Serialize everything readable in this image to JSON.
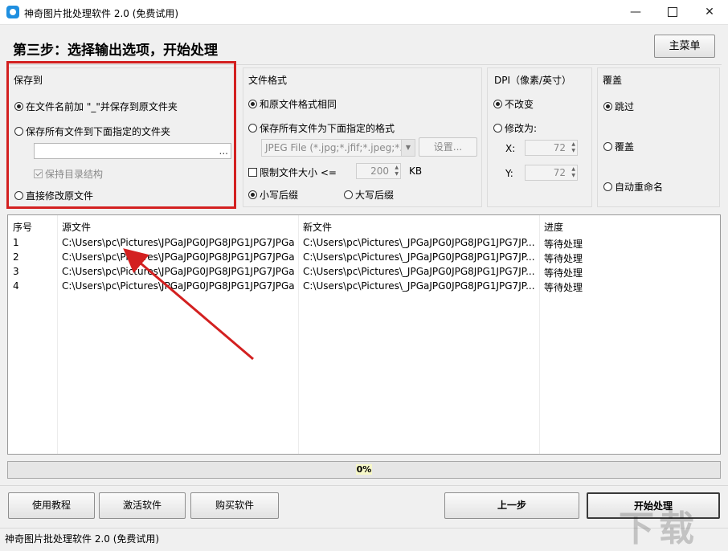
{
  "window": {
    "title": "神奇图片批处理软件 2.0 (免费试用)",
    "min_glyph": "—",
    "close_glyph": "✕"
  },
  "header": {
    "step_title": "第三步：选择输出选项，开始处理",
    "main_menu": "主菜单"
  },
  "save_to": {
    "title": "保存到",
    "option_prefix": "在文件名前加 \"_\"并保存到原文件夹",
    "option_folder": "保存所有文件到下面指定的文件夹",
    "folder_value": "",
    "browse": "...",
    "keep_structure": "保持目录结构",
    "option_overwrite": "直接修改原文件"
  },
  "file_format": {
    "title": "文件格式",
    "option_same": "和原文件格式相同",
    "option_convert": "保存所有文件为下面指定的格式",
    "format_value": "JPEG File (*.jpg;*.jfif;*.jpeg;*.jpe)",
    "settings": "设置...",
    "limit_size": "限制文件大小 <=",
    "limit_value": "200",
    "limit_unit": "KB",
    "lower_ext": "小写后缀",
    "upper_ext": "大写后缀"
  },
  "dpi": {
    "title": "DPI（像素/英寸）",
    "option_keep": "不改变",
    "option_change": "修改为:",
    "x_label": "X:",
    "x_value": "72",
    "y_label": "Y:",
    "y_value": "72"
  },
  "overwrite": {
    "title": "覆盖",
    "skip": "跳过",
    "cover": "覆盖",
    "rename": "自动重命名"
  },
  "table": {
    "headers": [
      "序号",
      "源文件",
      "新文件",
      "进度"
    ],
    "rows": [
      [
        "1",
        "C:\\Users\\pc\\Pictures\\JPGaJPG0JPG8JPG1JPG7JPGa...",
        "C:\\Users\\pc\\Pictures\\_JPGaJPG0JPG8JPG1JPG7JP...",
        "等待处理"
      ],
      [
        "2",
        "C:\\Users\\pc\\Pictures\\JPGaJPG0JPG8JPG1JPG7JPGa...",
        "C:\\Users\\pc\\Pictures\\_JPGaJPG0JPG8JPG1JPG7JP...",
        "等待处理"
      ],
      [
        "3",
        "C:\\Users\\pc\\Pictures\\JPGaJPG0JPG8JPG1JPG7JPGa...",
        "C:\\Users\\pc\\Pictures\\_JPGaJPG0JPG8JPG1JPG7JP...",
        "等待处理"
      ],
      [
        "4",
        "C:\\Users\\pc\\Pictures\\JPGaJPG0JPG8JPG1JPG7JPGa...",
        "C:\\Users\\pc\\Pictures\\_JPGaJPG0JPG8JPG1JPG7JP...",
        "等待处理"
      ]
    ]
  },
  "progress": {
    "label": "0%",
    "fraction": 0
  },
  "buttons": {
    "tutorial": "使用教程",
    "activate": "激活软件",
    "buy": "购买软件",
    "prev": "上一步",
    "start": "开始处理"
  },
  "status": {
    "text": "神奇图片批处理软件 2.0 (免费试用)"
  },
  "watermark": {
    "text": "下载"
  },
  "colors": {
    "annotation_red": "#d32020",
    "progress_green": "#06b025"
  }
}
